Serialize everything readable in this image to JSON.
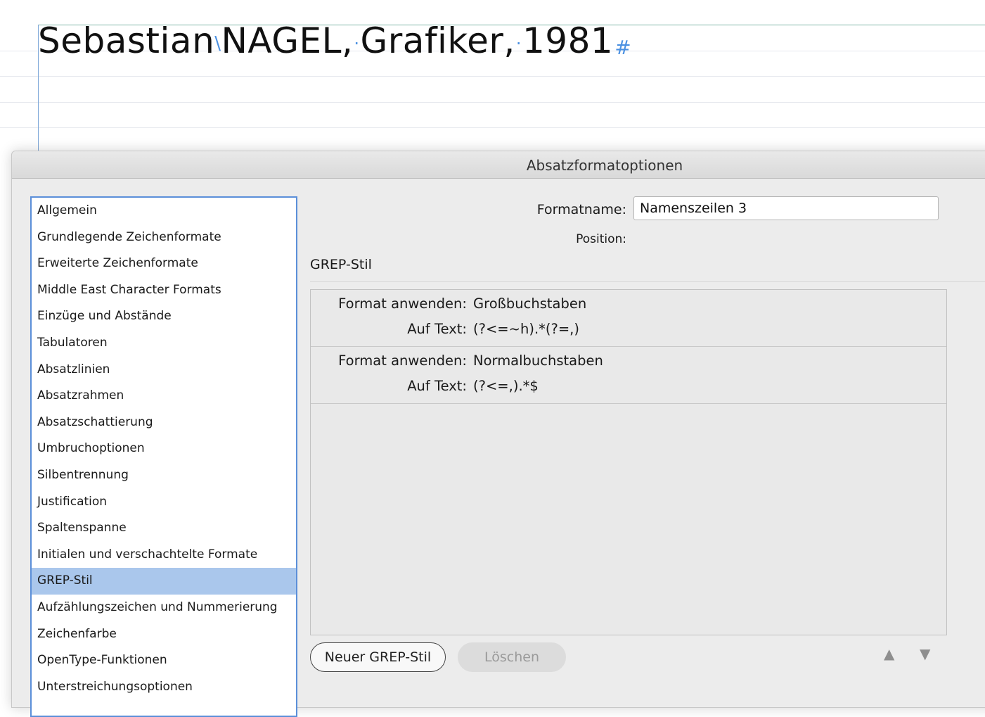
{
  "document": {
    "line": {
      "first": "Sebastian",
      "second": "NAGEL,",
      "third": "Grafiker,",
      "fourth": "1981"
    },
    "hidden_chars": {
      "discretionary": "\\",
      "space": "·",
      "end_of_story": "#"
    }
  },
  "dialog": {
    "title": "Absatzformatoptionen",
    "categories": [
      "Allgemein",
      "Grundlegende Zeichenformate",
      "Erweiterte Zeichenformate",
      "Middle East Character Formats",
      "Einzüge und Abstände",
      "Tabulatoren",
      "Absatzlinien",
      "Absatzrahmen",
      "Absatzschattierung",
      "Umbruchoptionen",
      "Silbentrennung",
      "Justification",
      "Spaltenspanne",
      "Initialen und verschachtelte Formate",
      "GREP-Stil",
      "Aufzählungszeichen und Nummerierung",
      "Zeichenfarbe",
      "OpenType-Funktionen",
      "Unterstreichungsoptionen"
    ],
    "selected_category": "GREP-Stil",
    "format_name_label": "Formatname:",
    "format_name_value": "Namenszeilen 3",
    "position_label": "Position:",
    "section_title": "GREP-Stil",
    "grep_styles": [
      {
        "apply_label": "Format anwenden:",
        "apply_value": "Großbuchstaben",
        "text_label": "Auf Text:",
        "text_value": "(?<=~h).*(?=,)"
      },
      {
        "apply_label": "Format anwenden:",
        "apply_value": "Normalbuchstaben",
        "text_label": "Auf Text:",
        "text_value": "(?<=,).*$"
      }
    ],
    "new_button": "Neuer GREP-Stil",
    "delete_button": "Löschen",
    "move_up": "▲",
    "move_down": "▼"
  }
}
